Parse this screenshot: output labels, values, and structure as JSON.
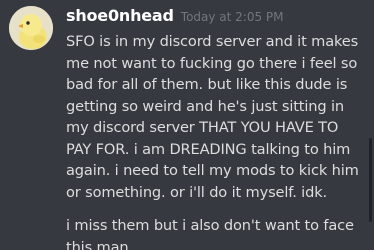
{
  "message": {
    "author": "shoe0nhead",
    "timestamp": "Today at 2:05 PM",
    "avatar_icon": "chick-avatar-icon",
    "paragraphs": [
      "SFO is in my discord server and it makes me not want to fucking go there i feel so bad for all of them. but like this dude is getting so weird and he's just sitting in my discord server THAT YOU HAVE TO PAY FOR. i am DREADING talking to him again. i need to tell my mods to kick him or something. or i'll do it myself. idk.",
      "i miss them but i also don't want to face this man"
    ]
  },
  "colors": {
    "background": "#36393f",
    "username": "#ffffff",
    "timestamp": "#72767d",
    "text": "#dcddde"
  }
}
